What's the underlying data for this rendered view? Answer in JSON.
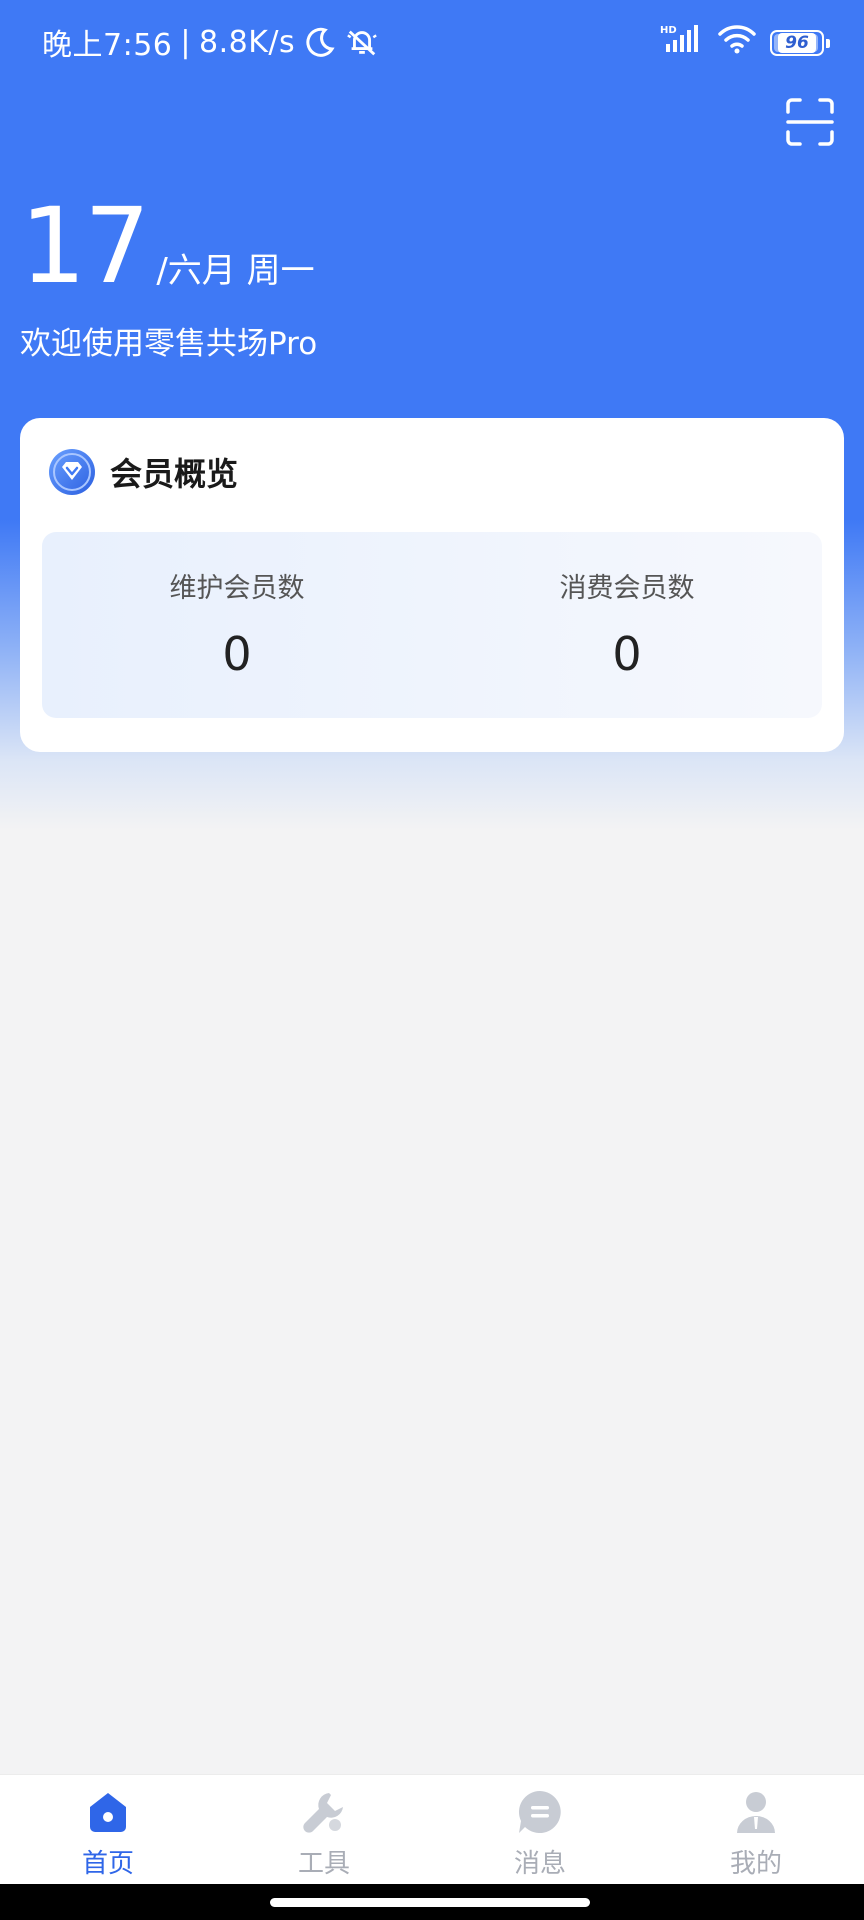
{
  "status_bar": {
    "time": "晚上7:56",
    "separator": "|",
    "speed": "8.8K/s",
    "hd_label": "HD",
    "battery": "96",
    "icons": [
      "moon-icon",
      "mute-bell-icon",
      "signal-icon",
      "wifi-icon",
      "battery-icon"
    ]
  },
  "header": {
    "day": "17",
    "month_weekday": "/六月 周一",
    "welcome": "欢迎使用零售共场Pro",
    "scan_icon": "scan-icon"
  },
  "member_card": {
    "title": "会员概览",
    "icon": "diamond-shield-icon",
    "stats": [
      {
        "label": "维护会员数",
        "value": "0"
      },
      {
        "label": "消费会员数",
        "value": "0"
      }
    ]
  },
  "bottom_nav": {
    "items": [
      {
        "label": "首页",
        "icon": "home-icon",
        "active": true
      },
      {
        "label": "工具",
        "icon": "wrench-icon",
        "active": false
      },
      {
        "label": "消息",
        "icon": "message-icon",
        "active": false
      },
      {
        "label": "我的",
        "icon": "person-icon",
        "active": false
      }
    ]
  },
  "colors": {
    "primary": "#3f79f5",
    "nav_active": "#2f66e8",
    "nav_inactive": "#a9adb6",
    "page_bg": "#f3f3f4"
  }
}
